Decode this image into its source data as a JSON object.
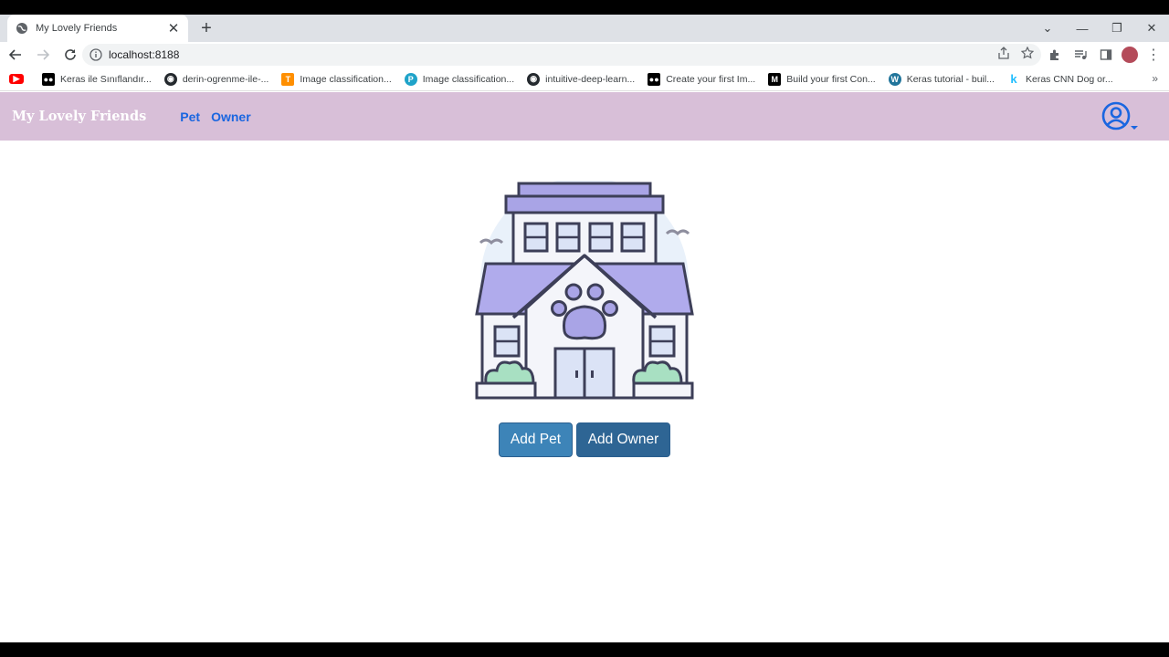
{
  "browser": {
    "tab_title": "My Lovely Friends",
    "url": "localhost:8188",
    "bookmarks": [
      {
        "label": "",
        "icon": "youtube-icon",
        "color": "#ff0000"
      },
      {
        "label": "Keras ile Sınıflandır...",
        "icon": "medium-icon",
        "color": "#000000"
      },
      {
        "label": "derin-ogrenme-ile-...",
        "icon": "github-icon",
        "color": "#24292e"
      },
      {
        "label": "Image classification...",
        "icon": "tensorflow-icon",
        "color": "#ff8f00"
      },
      {
        "label": "Image classification...",
        "icon": "paperspace-icon",
        "color": "#1fa3c9"
      },
      {
        "label": "intuitive-deep-learn...",
        "icon": "github-icon",
        "color": "#24292e"
      },
      {
        "label": "Create your first Im...",
        "icon": "medium-icon",
        "color": "#000000"
      },
      {
        "label": "Build your first Con...",
        "icon": "medium-m-icon",
        "color": "#000000"
      },
      {
        "label": "Keras tutorial - buil...",
        "icon": "wordpress-icon",
        "color": "#21759b"
      },
      {
        "label": "Keras CNN Dog or...",
        "icon": "kaggle-icon",
        "color": "#20beff"
      }
    ]
  },
  "app": {
    "brand": "My Lovely Friends",
    "nav": [
      {
        "label": "Pet"
      },
      {
        "label": "Owner"
      }
    ],
    "accent_color": "#1a66e0",
    "navbar_color": "#d8bfd8"
  },
  "main": {
    "image_icon": "pet-house-illustration",
    "buttons": {
      "add_pet": "Add Pet",
      "add_owner": "Add Owner"
    }
  }
}
